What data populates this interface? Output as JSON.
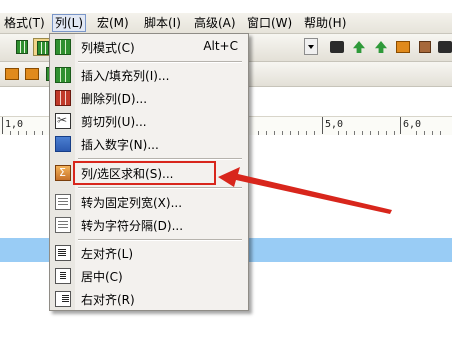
{
  "menubar": {
    "items": [
      {
        "label": "格式(T)"
      },
      {
        "label": "列(L)"
      },
      {
        "label": "宏(M)"
      },
      {
        "label": "脚本(I)"
      },
      {
        "label": "高级(A)"
      },
      {
        "label": "窗口(W)"
      },
      {
        "label": "帮助(H)"
      }
    ]
  },
  "column_menu": {
    "items": [
      {
        "label": "列模式(C)",
        "shortcut": "Alt+C",
        "icon": "column-mode-icon"
      },
      {
        "label": "插入/填充列(I)...",
        "icon": "insert-column-icon"
      },
      {
        "label": "删除列(D)...",
        "icon": "delete-column-icon"
      },
      {
        "label": "剪切列(U)...",
        "icon": "cut-column-icon"
      },
      {
        "label": "插入数字(N)...",
        "icon": "insert-number-icon"
      },
      {
        "label": "列/选区求和(S)...",
        "icon": "sum-icon"
      },
      {
        "label": "转为固定列宽(X)...",
        "icon": "fixed-width-icon"
      },
      {
        "label": "转为字符分隔(D)...",
        "icon": "delimited-icon"
      },
      {
        "label": "左对齐(L)",
        "icon": "align-left-icon"
      },
      {
        "label": "居中(C)",
        "icon": "align-center-icon"
      },
      {
        "label": "右对齐(R)",
        "icon": "align-right-icon"
      }
    ]
  },
  "ruler": {
    "labels": [
      "1,0",
      "5,0",
      "6,0"
    ]
  },
  "colors": {
    "annotation": "#d8261c",
    "selection_band": "#99ccf5",
    "menu_bg": "#f3f1ee"
  }
}
